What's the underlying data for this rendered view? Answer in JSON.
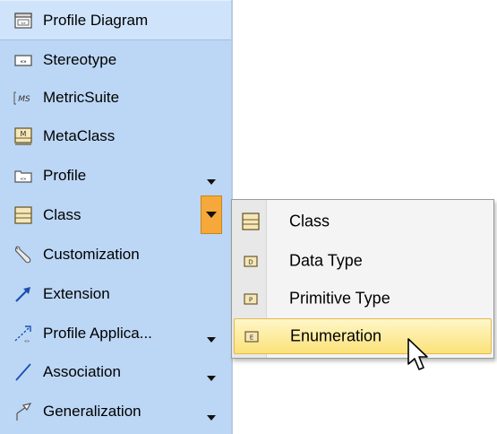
{
  "palette": {
    "header": {
      "label": "Profile Diagram",
      "icon": "diagram-icon"
    },
    "items": [
      {
        "label": "Stereotype",
        "icon": "stereotype-icon",
        "has_dropdown": false
      },
      {
        "label": "MetricSuite",
        "icon": "metric-suite-icon",
        "has_dropdown": false
      },
      {
        "label": "MetaClass",
        "icon": "metaclass-icon",
        "has_dropdown": false
      },
      {
        "label": "Profile",
        "icon": "profile-icon",
        "has_dropdown": true
      },
      {
        "label": "Class",
        "icon": "class-icon",
        "has_dropdown": true,
        "active": true
      },
      {
        "label": "Customization",
        "icon": "wrench-icon",
        "has_dropdown": false
      },
      {
        "label": "Extension",
        "icon": "extension-arrow-icon",
        "has_dropdown": false
      },
      {
        "label": "Profile Applica...",
        "icon": "profile-application-icon",
        "has_dropdown": true
      },
      {
        "label": "Association",
        "icon": "association-line-icon",
        "has_dropdown": true
      },
      {
        "label": "Generalization",
        "icon": "generalization-icon",
        "has_dropdown": true
      }
    ]
  },
  "popup_menu": {
    "items": [
      {
        "label": "Class",
        "icon": "class-icon"
      },
      {
        "label": "Data Type",
        "icon": "data-type-icon"
      },
      {
        "label": "Primitive Type",
        "icon": "primitive-type-icon"
      },
      {
        "label": "Enumeration",
        "icon": "enumeration-icon",
        "highlighted": true
      }
    ]
  },
  "colors": {
    "palette_bg": "#bcd7f5",
    "active_dropdown": "#f6a93a",
    "highlight": "#fbe27a"
  }
}
